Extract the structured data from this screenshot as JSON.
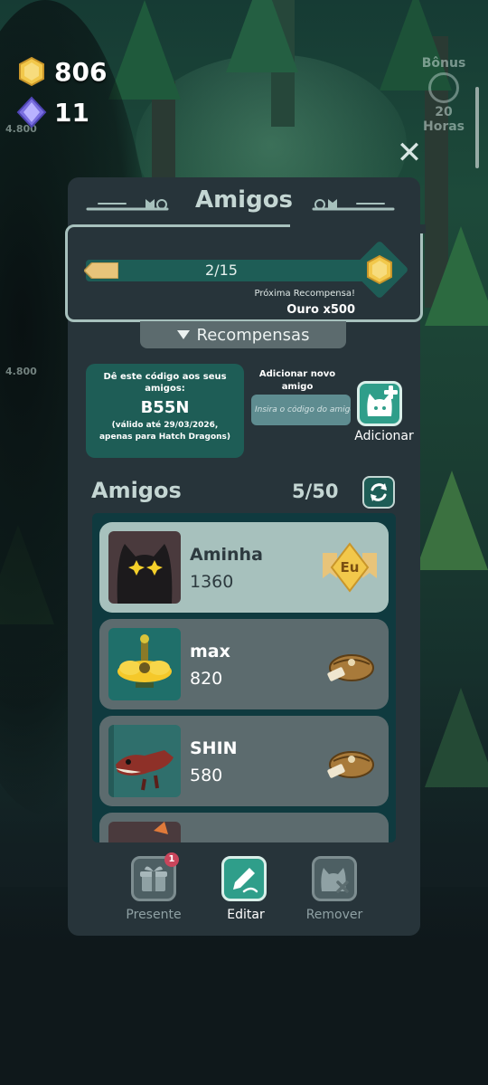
{
  "hud": {
    "gold": "806",
    "gems": "11",
    "bonus_label": "Bônus",
    "bonus_timer": "20 Horas",
    "bg_value_1": "4.800",
    "bg_value_2": "4.800"
  },
  "panel": {
    "title": "Amigos",
    "progress": {
      "text": "2/15",
      "current": 2,
      "total": 15
    },
    "next_reward_label": "Próxima Recompensa!",
    "next_reward_value": "Ouro x500",
    "rewards_tab": "Recompensas"
  },
  "share_code": {
    "instruction": "Dê este código aos seus amigos:",
    "code": "B55N",
    "validity": "(válido até 29/03/2026, apenas para Hatch Dragons)"
  },
  "add_friend": {
    "label": "Adicionar novo amigo",
    "placeholder": "Insira o código do amigo",
    "button_label": "Adicionar"
  },
  "friends": {
    "heading": "Amigos",
    "count": "5/50",
    "list": [
      {
        "name": "Aminha",
        "score": "1360",
        "badge": "Eu",
        "badge_icon": "me-ribbon-icon"
      },
      {
        "name": "max",
        "score": "820",
        "badge_icon": "gift-pouch-icon"
      },
      {
        "name": "SHIN",
        "score": "580",
        "badge_icon": "gift-pouch-icon"
      }
    ]
  },
  "actions": {
    "gift_label": "Presente",
    "gift_badge": "1",
    "edit_label": "Editar",
    "remove_label": "Remover"
  },
  "colors": {
    "panel": "#27343a",
    "accent_teal": "#1e5d56",
    "highlight_row": "#a7c1bd",
    "row": "#5c6b6e",
    "gold": "#f2c84b",
    "notification": "#c9455b"
  }
}
